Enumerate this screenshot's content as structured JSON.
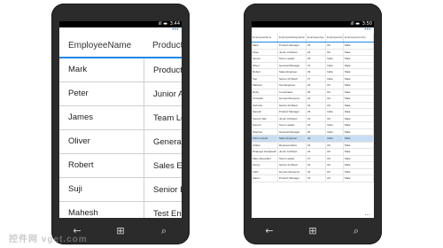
{
  "left_phone": {
    "status": {
      "icons": "ıll ▬",
      "time": "3:44"
    },
    "headers": [
      "EmployeeName",
      "Product"
    ],
    "rows": [
      [
        "Mark",
        "Product M"
      ],
      [
        "Peter",
        "Junior A"
      ],
      [
        "James",
        "Team Le"
      ],
      [
        "Oliver",
        "General"
      ],
      [
        "Robert",
        "Sales En"
      ],
      [
        "Suji",
        "Senior E"
      ],
      [
        "Mahesh",
        "Test En"
      ]
    ],
    "menu_dots": "•••",
    "bottom_dots": "..."
  },
  "right_phone": {
    "status": {
      "icons": "ıll ▬",
      "time": "3:50"
    },
    "headers": [
      "EmployeeName",
      "EmployeeDesignation",
      "EmployeeAge",
      "EmployeeArea",
      "EmployeeCountry"
    ],
    "rows": [
      [
        "Mark",
        "Product Manager",
        "32",
        "UK",
        "Male"
      ],
      [
        "Peter",
        "Junior Architect",
        "23",
        "UK",
        "Male"
      ],
      [
        "James",
        "Team Leader",
        "26",
        "India",
        "Male"
      ],
      [
        "Oliver",
        "General Manager",
        "37",
        "India",
        "Male"
      ],
      [
        "Robert",
        "Sales Engineer",
        "32",
        "India",
        "Male"
      ],
      [
        "Suji",
        "Senior Architect",
        "27",
        "India",
        "Male"
      ],
      [
        "Mahesh",
        "Test Engineer",
        "24",
        "UK",
        "Male"
      ],
      [
        "Ruby",
        "Coordinator",
        "25",
        "UK",
        "Male"
      ],
      [
        "Christeth",
        "Human Resource",
        "22",
        "UK",
        "Male"
      ],
      [
        "Kishmid",
        "Senior Architect",
        "24",
        "UK",
        "Male"
      ],
      [
        "Sanesh",
        "Product Manager",
        "25",
        "India",
        "Male"
      ],
      [
        "Suresh Jain",
        "Junior Architect",
        "22",
        "UK",
        "Male"
      ],
      [
        "Suresh",
        "Team Leader",
        "22",
        "India",
        "Male"
      ],
      [
        "Stephen",
        "General Manager",
        "25",
        "India",
        "Male"
      ],
      [
        "Asha Joseph",
        "Sales Engineer",
        "32",
        "India",
        "Male"
      ],
      [
        "Clarke",
        "Representative",
        "32",
        "UK",
        "Male"
      ],
      [
        "Dhanaya Venkatesh",
        "Junior Architect",
        "23",
        "UK",
        "Male"
      ],
      [
        "Mary Alexander",
        "Team Leader",
        "27",
        "UK",
        "Male"
      ],
      [
        "Kenny",
        "Senior Architect",
        "22",
        "UK",
        "Male"
      ],
      [
        "Fathi",
        "Human Resource",
        "32",
        "UK",
        "Male"
      ],
      [
        "Salom",
        "Product Manager",
        "32",
        "UK",
        "Male"
      ]
    ],
    "selected_row": 14,
    "menu_dots": "•••",
    "bottom_dots": "..."
  },
  "nav": {
    "back": "←",
    "start": "⊞",
    "search": "⌕"
  },
  "watermark": "控件网 vget.com"
}
